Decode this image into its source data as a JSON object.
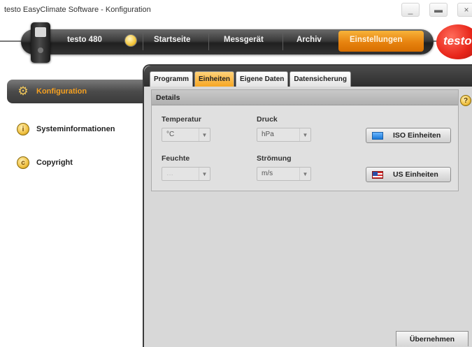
{
  "window": {
    "title": "testo EasyClimate Software - Konfiguration",
    "minimize_glyph": "_",
    "maximize_glyph": "▬",
    "close_glyph": "×"
  },
  "nav": {
    "device_label": "testo 480",
    "items": [
      {
        "label": "Startseite"
      },
      {
        "label": "Messgerät"
      },
      {
        "label": "Archiv"
      },
      {
        "label": "Einstellungen",
        "active": true
      }
    ],
    "logo_text": "testo",
    "active_color": "#f39a1a"
  },
  "sidebar": {
    "items": [
      {
        "label": "Konfiguration",
        "icon": "gear-icon",
        "active": true
      },
      {
        "label": "Systeminformationen",
        "icon": "info-icon",
        "glyph": "i"
      },
      {
        "label": "Copyright",
        "icon": "copyright-icon",
        "glyph": "c"
      }
    ]
  },
  "tabs": [
    {
      "label": "Programm"
    },
    {
      "label": "Einheiten",
      "active": true
    },
    {
      "label": "Eigene Daten"
    },
    {
      "label": "Datensicherung"
    }
  ],
  "details": {
    "header": "Details",
    "temperature": {
      "label": "Temperatur",
      "value": "°C"
    },
    "pressure": {
      "label": "Druck",
      "value": "hPa"
    },
    "humidity": {
      "label": "Feuchte",
      "value": "…"
    },
    "flow": {
      "label": "Strömung",
      "value": "m/s"
    },
    "iso_button": "ISO Einheiten",
    "us_button": "US Einheiten"
  },
  "help_glyph": "?",
  "apply_button": "Übernehmen"
}
